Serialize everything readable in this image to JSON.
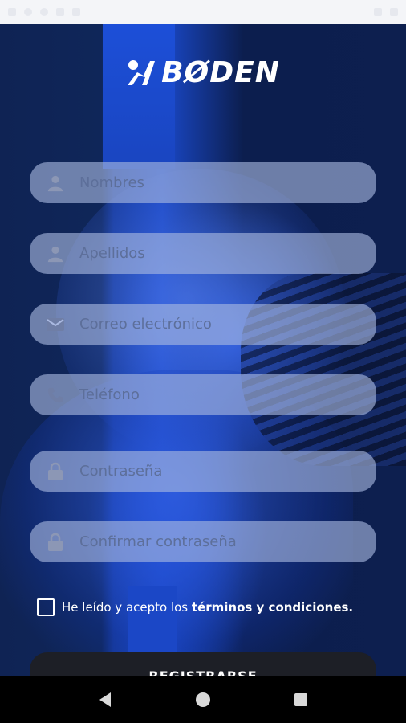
{
  "app": {
    "logo_text": "BØDEN"
  },
  "fields": [
    {
      "placeholder": "Nombres",
      "icon": "person-icon"
    },
    {
      "placeholder": "Apellidos",
      "icon": "person-icon"
    },
    {
      "placeholder": "Correo electrónico",
      "icon": "mail-icon"
    },
    {
      "placeholder": "Teléfono",
      "icon": "phone-icon"
    },
    {
      "placeholder": "Contraseña",
      "icon": "lock-icon"
    },
    {
      "placeholder": "Confirmar contraseña",
      "icon": "lock-icon"
    }
  ],
  "terms": {
    "prefix": "He leído y acepto los ",
    "link": "términos y condiciones.",
    "checked": false
  },
  "register_button": {
    "label": "REGISTRARSE"
  },
  "colors": {
    "accent": "#1a48c8",
    "field_bg": "#aab9e1",
    "button_bg": "#1d1f26"
  }
}
